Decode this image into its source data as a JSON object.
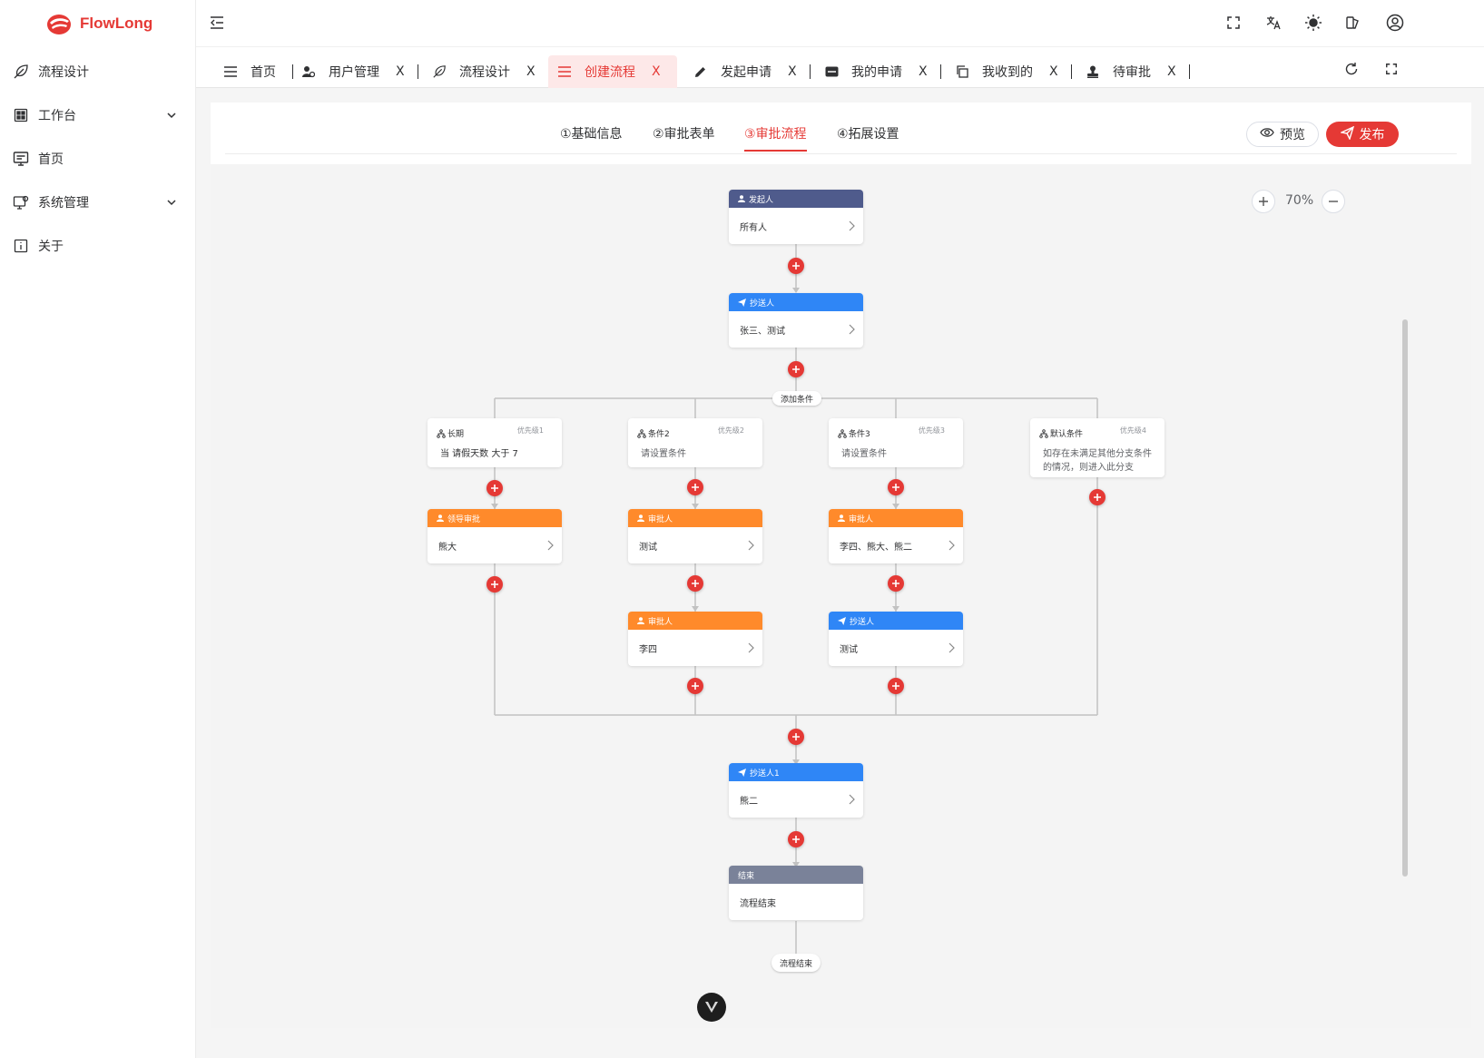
{
  "app": {
    "name": "FlowLong"
  },
  "sidebar": {
    "items": [
      {
        "label": "流程设计",
        "icon": "feather-icon"
      },
      {
        "label": "工作台",
        "icon": "grid-icon",
        "expandable": true
      },
      {
        "label": "首页",
        "icon": "monitor-icon"
      },
      {
        "label": "系统管理",
        "icon": "settings-monitor-icon",
        "expandable": true
      },
      {
        "label": "关于",
        "icon": "info-icon"
      }
    ]
  },
  "header": {
    "icons": [
      "fullscreen-icon",
      "translate-icon",
      "sun-icon",
      "theme-icon",
      "user-icon"
    ]
  },
  "tabs": [
    {
      "label": "首页",
      "close": "X",
      "icon": "menu-icon"
    },
    {
      "label": "用户管理",
      "close": "X",
      "icon": "user-settings-icon"
    },
    {
      "label": "流程设计",
      "close": "X",
      "icon": "feather-icon"
    },
    {
      "label": "创建流程",
      "close": "X",
      "icon": "menu-icon",
      "active": true
    },
    {
      "label": "发起申请",
      "close": "X",
      "icon": "pencil-icon"
    },
    {
      "label": "我的申请",
      "close": "X",
      "icon": "card-icon"
    },
    {
      "label": "我收到的",
      "close": "X",
      "icon": "copy-icon"
    },
    {
      "label": "待审批",
      "close": "X",
      "icon": "stamp-icon"
    }
  ],
  "steps": [
    "①基础信息",
    "②审批表单",
    "③审批流程",
    "④拓展设置"
  ],
  "active_step": 2,
  "buttons": {
    "preview": "预览",
    "publish": "发布"
  },
  "zoom": {
    "value": "70%"
  },
  "flow": {
    "initiator": {
      "header": "发起人",
      "body": "所有人"
    },
    "cc1": {
      "header": "抄送人",
      "body": "张三、测试"
    },
    "add_condition": "添加条件",
    "conditions": [
      {
        "title": "长期",
        "priority": "优先级1",
        "body": "当 请假天数 大于 7"
      },
      {
        "title": "条件2",
        "priority": "优先级2",
        "body": "请设置条件"
      },
      {
        "title": "条件3",
        "priority": "优先级3",
        "body": "请设置条件"
      },
      {
        "title": "默认条件",
        "priority": "优先级4",
        "body": "如存在未满足其他分支条件的情况，则进入此分支"
      }
    ],
    "branch_nodes": [
      {
        "header": "领导审批",
        "body": "熊大",
        "type": "approver"
      },
      {
        "header": "审批人",
        "body": "测试",
        "type": "approver"
      },
      {
        "header": "审批人",
        "body": "李四、熊大、熊二",
        "type": "approver"
      },
      {
        "header": "审批人",
        "body": "李四",
        "type": "approver"
      },
      {
        "header": "抄送人",
        "body": "测试",
        "type": "cc"
      }
    ],
    "cc2": {
      "header": "抄送人1",
      "body": "熊二"
    },
    "end_node": {
      "header": "结束",
      "body": "流程结束"
    },
    "end_pill": "流程结束"
  },
  "colors": {
    "accent": "#e53935",
    "initiator": "#4f5b8c",
    "cc": "#2f86f6",
    "approver": "#ff8a2b",
    "end": "#7a8299"
  }
}
